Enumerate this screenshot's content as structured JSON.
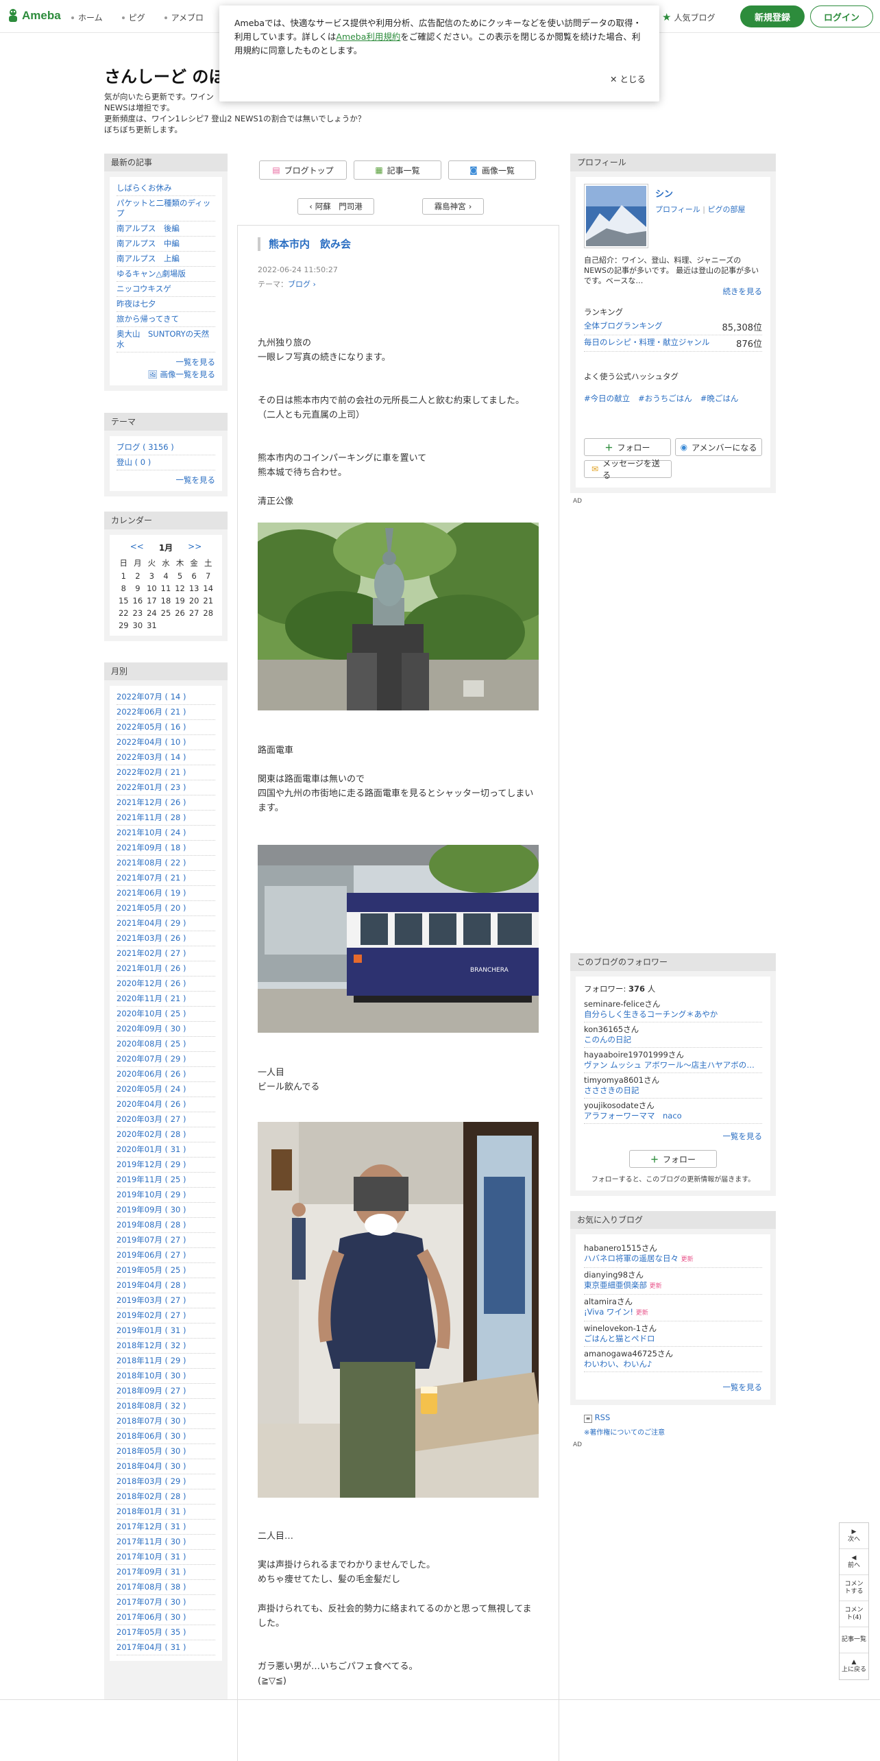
{
  "topbar": {
    "logo": "Ameba",
    "nav": [
      "ホーム",
      "ピグ",
      "アメブロ"
    ],
    "popular": "人気ブログ",
    "signup": "新規登録",
    "login": "ログイン"
  },
  "cookie": {
    "text1": "Amebaでは、快適なサービス提供や利用分析、広告配信のためにクッキーなどを使い訪問データの取得・利用しています。詳しくは",
    "link": "Ameba利用規約",
    "text2": "をご確認ください。この表示を閉じるか閲覧を続けた場合、利用規約に同意したものとします。",
    "close": "とじる"
  },
  "blog": {
    "title": "さんしーど のほ",
    "desc": [
      "気が向いたら更新です。ワイン",
      "NEWSは増担です。",
      "更新頻度は、ワイン1レシピ7 登山2 NEWS1の割合では無いでしょうか？",
      "ぼちぼち更新します。"
    ]
  },
  "left": {
    "latest_h": "最新の記事",
    "latest": [
      "しばらくお休み",
      "パケットと二種類のディップ",
      "南アルプス　後編",
      "南アルプス　中編",
      "南アルプス　上編",
      "ゆるキャン△劇場版",
      "ニッコウキスゲ",
      "昨夜は七夕",
      "旅から帰ってきて",
      "奥大山　SUNTORYの天然水"
    ],
    "latest_more": "一覧を見る",
    "latest_img_more": "画像一覧を見る",
    "theme_h": "テーマ",
    "themes": [
      "ブログ ( 3156 )",
      "登山 ( 0 )"
    ],
    "theme_more": "一覧を見る",
    "cal_h": "カレンダー",
    "cal_prev": "<<",
    "cal_month": "1月",
    "cal_next": ">>",
    "cal_days": [
      "日",
      "月",
      "火",
      "水",
      "木",
      "金",
      "土"
    ],
    "cal_dates": [
      "1",
      "2",
      "3",
      "4",
      "5",
      "6",
      "7",
      "8",
      "9",
      "10",
      "11",
      "12",
      "13",
      "14",
      "15",
      "16",
      "17",
      "18",
      "19",
      "20",
      "21",
      "22",
      "23",
      "24",
      "25",
      "26",
      "27",
      "28",
      "29",
      "30",
      "31"
    ],
    "month_h": "月別",
    "months": [
      "2022年07月 ( 14 )",
      "2022年06月 ( 21 )",
      "2022年05月 ( 16 )",
      "2022年04月 ( 10 )",
      "2022年03月 ( 14 )",
      "2022年02月 ( 21 )",
      "2022年01月 ( 23 )",
      "2021年12月 ( 26 )",
      "2021年11月 ( 28 )",
      "2021年10月 ( 24 )",
      "2021年09月 ( 18 )",
      "2021年08月 ( 22 )",
      "2021年07月 ( 21 )",
      "2021年06月 ( 19 )",
      "2021年05月 ( 20 )",
      "2021年04月 ( 29 )",
      "2021年03月 ( 26 )",
      "2021年02月 ( 27 )",
      "2021年01月 ( 26 )",
      "2020年12月 ( 26 )",
      "2020年11月 ( 21 )",
      "2020年10月 ( 25 )",
      "2020年09月 ( 30 )",
      "2020年08月 ( 25 )",
      "2020年07月 ( 29 )",
      "2020年06月 ( 26 )",
      "2020年05月 ( 24 )",
      "2020年04月 ( 26 )",
      "2020年03月 ( 27 )",
      "2020年02月 ( 28 )",
      "2020年01月 ( 31 )",
      "2019年12月 ( 29 )",
      "2019年11月 ( 25 )",
      "2019年10月 ( 29 )",
      "2019年09月 ( 30 )",
      "2019年08月 ( 28 )",
      "2019年07月 ( 27 )",
      "2019年06月 ( 27 )",
      "2019年05月 ( 25 )",
      "2019年04月 ( 28 )",
      "2019年03月 ( 27 )",
      "2019年02月 ( 27 )",
      "2019年01月 ( 31 )",
      "2018年12月 ( 32 )",
      "2018年11月 ( 29 )",
      "2018年10月 ( 30 )",
      "2018年09月 ( 27 )",
      "2018年08月 ( 32 )",
      "2018年07月 ( 30 )",
      "2018年06月 ( 30 )",
      "2018年05月 ( 30 )",
      "2018年04月 ( 30 )",
      "2018年03月 ( 29 )",
      "2018年02月 ( 28 )",
      "2018年01月 ( 31 )",
      "2017年12月 ( 31 )",
      "2017年11月 ( 30 )",
      "2017年10月 ( 31 )",
      "2017年09月 ( 31 )",
      "2017年08月 ( 38 )",
      "2017年07月 ( 30 )",
      "2017年06月 ( 30 )",
      "2017年05月 ( 35 )",
      "2017年04月 ( 31 )"
    ]
  },
  "main": {
    "btn_top": "ブログトップ",
    "btn_list": "記事一覧",
    "btn_img": "画像一覧",
    "prev": "阿蘇　門司港",
    "next": "霧島神宮",
    "title": "熊本市内　飲み会",
    "date": "2022-06-24 11:50:27",
    "theme_label": "テーマ：",
    "theme_link": "ブログ",
    "p1": [
      "九州独り旅の",
      "一眼レフ写真の続きになります。"
    ],
    "p2": [
      "その日は熊本市内で前の会社の元所長二人と飲む約束してました。（二人とも元直属の上司）"
    ],
    "p3": [
      "熊本市内のコインパーキングに車を置いて",
      "熊本城で待ち合わせ。"
    ],
    "p4": [
      "清正公像"
    ],
    "p5": [
      "路面電車"
    ],
    "p6": [
      "関東は路面電車は無いので",
      "四国や九州の市街地に走る路面電車を見るとシャッター切ってしまいます。"
    ],
    "p7": [
      "一人目",
      "ビール飲んでる"
    ],
    "p8": [
      "二人目…"
    ],
    "p9": [
      "実は声掛けられるまでわかりませんでした。",
      "めちゃ痩せてたし、髪の毛金髪だし"
    ],
    "p10": [
      "声掛けられても、反社会的勢力に絡まれてるのかと思って無視してました。"
    ],
    "p11": [
      "ガラ悪い男が…いちごパフェ食べてる。",
      "(≧▽≦)"
    ],
    "tram_text": "BRANCHERA"
  },
  "right": {
    "profile_h": "プロフィール",
    "name": "シン",
    "profile_link": "プロフィール",
    "pig_link": "ピグの部屋",
    "intro": "自己紹介：ワイン、登山、料理、ジャニーズのNEWSの記事が多いです。 最近は登山の記事が多いです。ベースな…",
    "intro_more": "続きを見る",
    "ranking_h": "ランキング",
    "rank1_label": "全体ブログランキング",
    "rank1_val": "85,308位",
    "rank2_label": "毎日のレシピ・料理・献立ジャンル",
    "rank2_val": "876位",
    "hashtag_h": "よく使う公式ハッシュタグ",
    "hashtags": [
      "#今日の献立",
      "#おうちごはん",
      "#晩ごはん"
    ],
    "btn_follow": "フォロー",
    "btn_amember": "アメンバーになる",
    "btn_message": "メッセージを送る",
    "ad": "AD",
    "followers_h": "このブログのフォロワー",
    "followers_label": "フォロワー:",
    "followers_count": "376",
    "followers_unit": "人",
    "followers": [
      {
        "user": "seminare-feliceさん",
        "blog": "自分らしく生きるコーチング＊あやか"
      },
      {
        "user": "kon36165さん",
        "blog": "このんの日記"
      },
      {
        "user": "hayaaboire19701999さん",
        "blog": "ヴァン ムッシュ アボワール〜店主ハヤアボのワイン"
      },
      {
        "user": "timyomya8601さん",
        "blog": "さささきの日記"
      },
      {
        "user": "youjikosodateさん",
        "blog": "アラフォーワーママ　naco"
      }
    ],
    "followers_more": "一覧を見る",
    "follow_btn2": "フォロー",
    "follow_note": "フォローすると、このブログの更新情報が届きます。",
    "fav_h": "お気に入りブログ",
    "favs": [
      {
        "user": "habanero1515さん",
        "blog": "ハバネロ将軍の遥居な日々",
        "upd": "更新"
      },
      {
        "user": "dianying98さん",
        "blog": "東京亜細亜倶楽部",
        "upd": "更新"
      },
      {
        "user": "altamiraさん",
        "blog": "¡Viva ワイン!",
        "upd": "更新"
      },
      {
        "user": "winelovekon-1さん",
        "blog": "ごはんと猫とペドロ",
        "upd": ""
      },
      {
        "user": "amanogawa46725さん",
        "blog": "わいわい、わいん♪",
        "upd": ""
      }
    ],
    "fav_more": "一覧を見る",
    "rss": "RSS",
    "copyright": "※著作権についてのご注意",
    "ad2": "AD"
  },
  "floatnav": {
    "next": "次へ",
    "prev": "前へ",
    "comment": "コメントする",
    "comment_count": "コメント(4)",
    "list": "記事一覧",
    "top": "上に戻る"
  }
}
